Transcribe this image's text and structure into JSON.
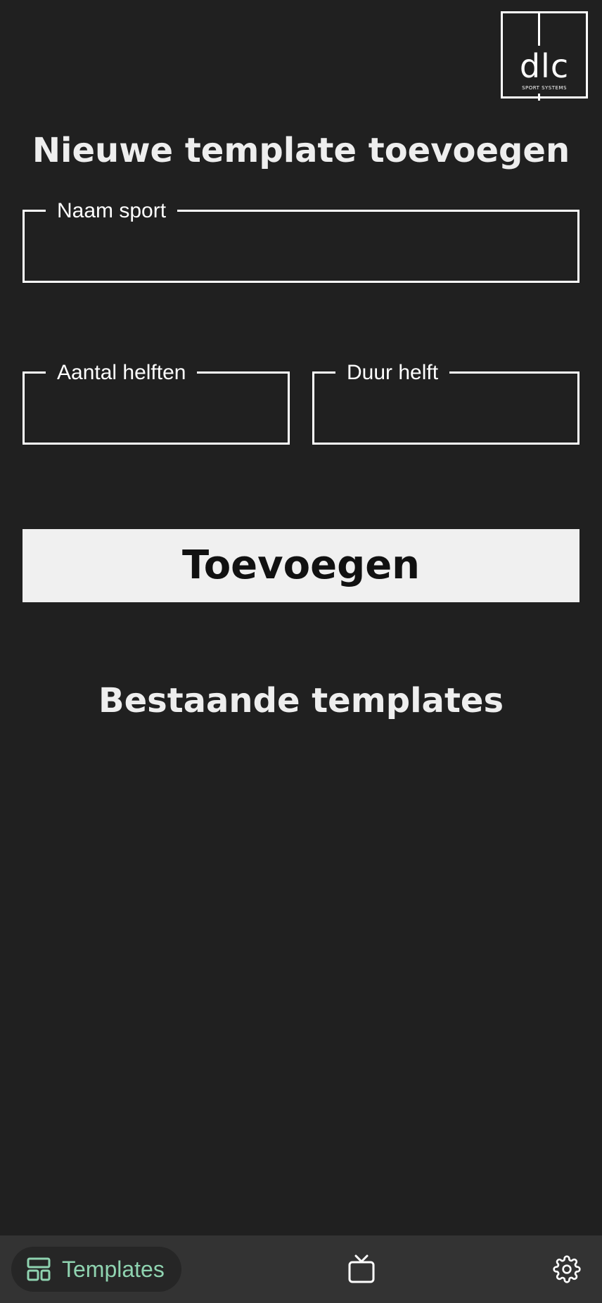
{
  "logo": {
    "mark": "dlc",
    "tagline": "SPORT SYSTEMS"
  },
  "form": {
    "title": "Nieuwe template toevoegen",
    "fields": {
      "naam_sport": {
        "label": "Naam sport",
        "value": ""
      },
      "aantal_helften": {
        "label": "Aantal helften",
        "value": ""
      },
      "duur_helft": {
        "label": "Duur helft",
        "value": ""
      }
    },
    "submit_label": "Toevoegen"
  },
  "existing": {
    "title": "Bestaande templates",
    "items": []
  },
  "nav": {
    "items": [
      {
        "label": "Templates",
        "icon": "layout-icon",
        "active": true
      },
      {
        "label": "",
        "icon": "tv-icon",
        "active": false
      },
      {
        "label": "",
        "icon": "gear-icon",
        "active": false
      }
    ]
  },
  "colors": {
    "background": "#202020",
    "navbar": "#333333",
    "accent": "#8fd3b0",
    "button": "#f0f0f0"
  }
}
